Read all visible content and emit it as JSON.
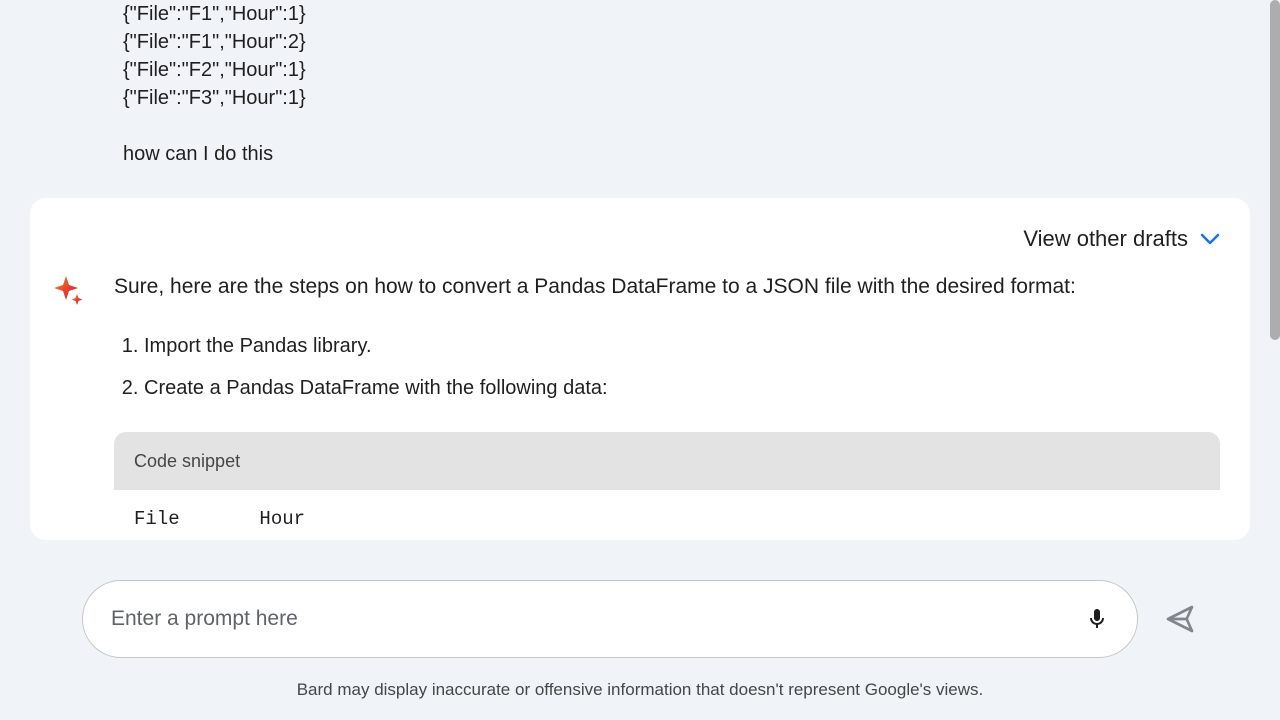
{
  "user_message": {
    "lines": [
      "{\"File\":\"F1\",\"Hour\":1}",
      "{\"File\":\"F1\",\"Hour\":2}",
      "{\"File\":\"F2\",\"Hour\":1}",
      "{\"File\":\"F3\",\"Hour\":1}"
    ],
    "question": "how can I do this"
  },
  "drafts": {
    "label": "View other drafts"
  },
  "response": {
    "intro": "Sure, here are the steps on how to convert a Pandas DataFrame to a JSON file with the desired format:",
    "steps": [
      "Import the Pandas library.",
      "Create a Pandas DataFrame with the following data:"
    ],
    "snippet_label": "Code snippet",
    "snippet_code": "File       Hour"
  },
  "input": {
    "placeholder": "Enter a prompt here"
  },
  "disclaimer": "Bard may display inaccurate or offensive information that doesn't represent Google's views."
}
